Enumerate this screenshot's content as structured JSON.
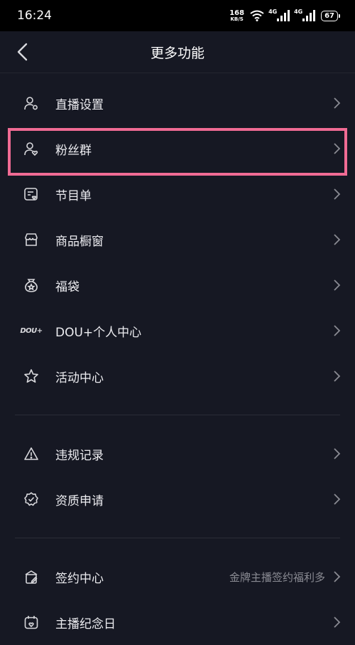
{
  "status_bar": {
    "time": "16:24",
    "speed_value": "168",
    "speed_unit": "KB/S",
    "net1": "4G",
    "net2": "4G",
    "battery": "67"
  },
  "nav": {
    "title": "更多功能"
  },
  "group1": [
    {
      "label": "直播设置",
      "icon": "user-settings-icon"
    },
    {
      "label": "粉丝群",
      "icon": "fan-group-icon"
    },
    {
      "label": "节目单",
      "icon": "program-list-icon"
    },
    {
      "label": "商品橱窗",
      "icon": "shop-window-icon"
    },
    {
      "label": "福袋",
      "icon": "lucky-bag-icon"
    },
    {
      "label": "DOU+个人中心",
      "icon": "dou-icon",
      "icon_text": "DOU+"
    },
    {
      "label": "活动中心",
      "icon": "star-icon"
    }
  ],
  "group2": [
    {
      "label": "违规记录",
      "icon": "warning-icon"
    },
    {
      "label": "资质申请",
      "icon": "badge-check-icon"
    }
  ],
  "group3": [
    {
      "label": "签约中心",
      "icon": "contract-icon",
      "subtitle": "金牌主播签约福利多"
    },
    {
      "label": "主播纪念日",
      "icon": "calendar-icon"
    }
  ],
  "colors": {
    "background": "#161823",
    "highlight": "#f06b94"
  }
}
